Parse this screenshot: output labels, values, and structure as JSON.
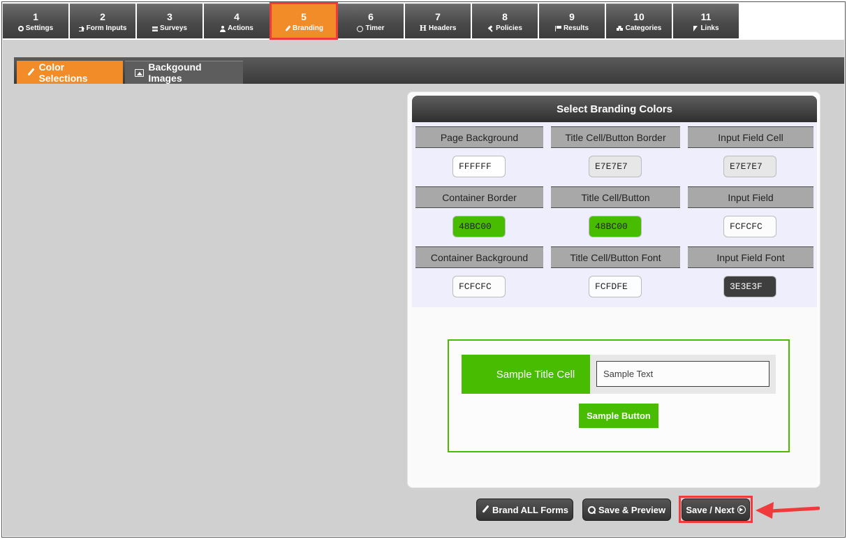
{
  "steps": [
    {
      "num": "1",
      "label": "Settings",
      "icon": "gear-icon"
    },
    {
      "num": "2",
      "label": "Form Inputs",
      "icon": "sign-in-icon"
    },
    {
      "num": "3",
      "label": "Surveys",
      "icon": "bars-icon"
    },
    {
      "num": "4",
      "label": "Actions",
      "icon": "user-icon"
    },
    {
      "num": "5",
      "label": "Branding",
      "icon": "paint-brush-icon"
    },
    {
      "num": "6",
      "label": "Timer",
      "icon": "clock-icon"
    },
    {
      "num": "7",
      "label": "Headers",
      "icon": "header-icon"
    },
    {
      "num": "8",
      "label": "Policies",
      "icon": "gavel-icon"
    },
    {
      "num": "9",
      "label": "Results",
      "icon": "flag-icon"
    },
    {
      "num": "10",
      "label": "Categories",
      "icon": "cubes-icon"
    },
    {
      "num": "11",
      "label": "Links",
      "icon": "cursor-icon"
    }
  ],
  "active_step": "5",
  "subtabs": {
    "color_selections": "Color Selections",
    "background_images": "Backgound Images"
  },
  "panel": {
    "title": "Select Branding Colors",
    "fields": [
      {
        "label": "Page Background",
        "value": "FFFFFF",
        "color": "#FFFFFF",
        "text_color": "#222222"
      },
      {
        "label": "Title Cell/Button Border",
        "value": "E7E7E7",
        "color": "#E7E7E7",
        "text_color": "#222222"
      },
      {
        "label": "Input Field Cell",
        "value": "E7E7E7",
        "color": "#E7E7E7",
        "text_color": "#222222"
      },
      {
        "label": "Container Border",
        "value": "48BC00",
        "color": "#48BC00",
        "text_color": "#222222"
      },
      {
        "label": "Title Cell/Button",
        "value": "48BC00",
        "color": "#48BC00",
        "text_color": "#222222"
      },
      {
        "label": "Input Field",
        "value": "FCFCFC",
        "color": "#FCFCFC",
        "text_color": "#222222"
      },
      {
        "label": "Container Background",
        "value": "FCFCFC",
        "color": "#FCFCFC",
        "text_color": "#222222"
      },
      {
        "label": "Title Cell/Button Font",
        "value": "FCFDFE",
        "color": "#FCFDFE",
        "text_color": "#222222"
      },
      {
        "label": "Input Field Font",
        "value": "3E3E3F",
        "color": "#3E3E3F",
        "text_color": "#FFFFFF"
      }
    ]
  },
  "preview": {
    "title_cell": "Sample Title Cell",
    "input_text": "Sample Text",
    "button": "Sample Button"
  },
  "buttons": {
    "brand_all": "Brand ALL Forms",
    "save_preview": "Save & Preview",
    "save_next": "Save / Next"
  },
  "colors": {
    "accent_orange": "#F28C28",
    "highlight_red": "#EF3B3B",
    "brand_green": "#48BC00"
  }
}
